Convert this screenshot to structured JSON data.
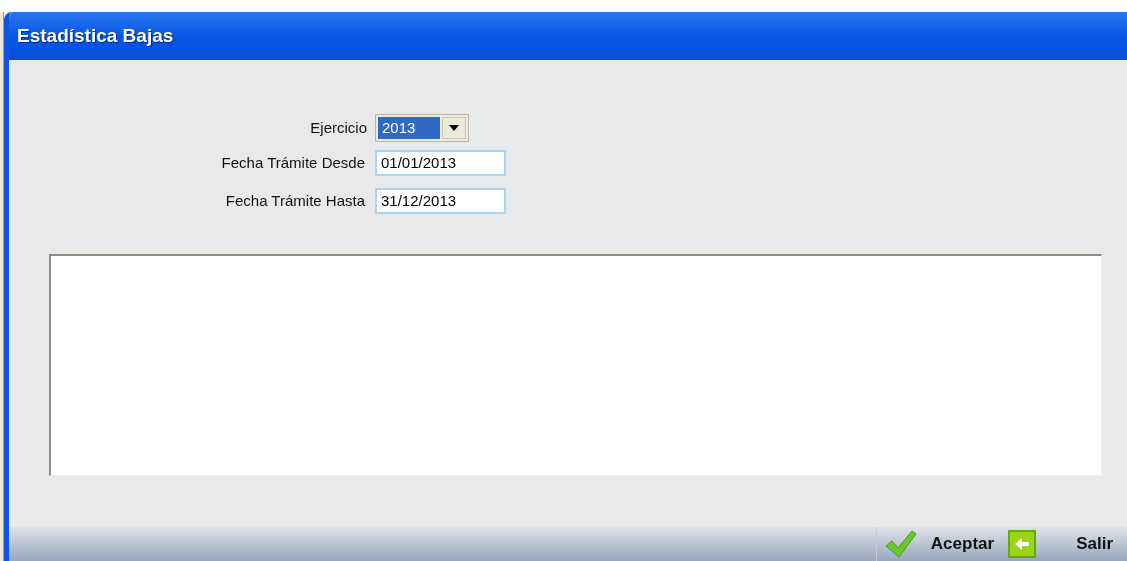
{
  "window": {
    "title": "Estadística Bajas"
  },
  "fields": [
    {
      "kind": "dropdown",
      "label": "Ejercicio",
      "value": "2013",
      "highlighted": true
    },
    {
      "kind": "text",
      "label": "Fecha Trámite Desde",
      "value": "01/01/2013"
    },
    {
      "kind": "text",
      "label": "Fecha Trámite Hasta",
      "value": "31/12/2013"
    }
  ],
  "buttons": [
    {
      "kind": "accept",
      "label": "Aceptar"
    },
    {
      "kind": "exit",
      "label": "Salir"
    }
  ]
}
